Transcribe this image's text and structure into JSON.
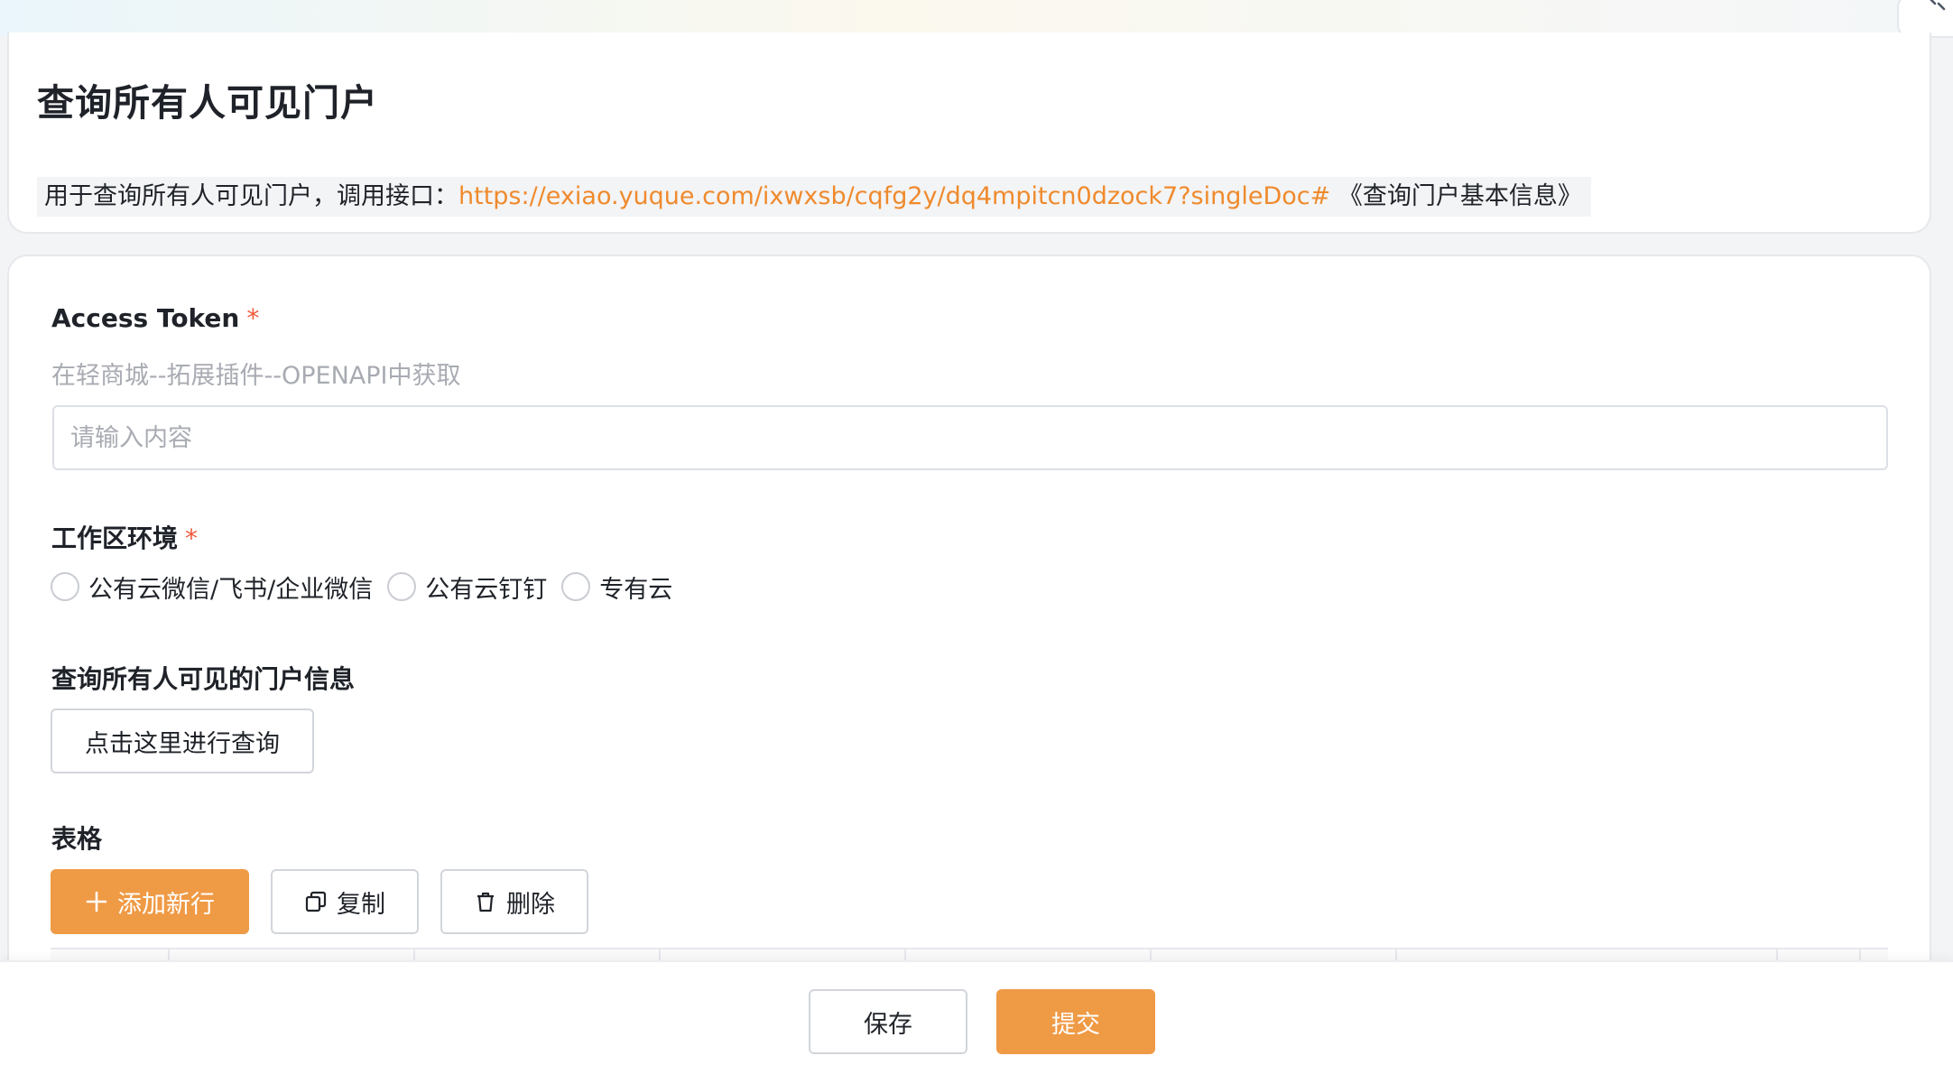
{
  "header": {
    "title": "查询所有人可见门户",
    "description_prefix": "用于查询所有人可见门户，调用接口：",
    "description_link": "https://exiao.yuque.com/ixwxsb/cqfg2y/dq4mpitcn0dzock7?singleDoc#",
    "description_suffix": " 《查询门户基本信息》"
  },
  "form": {
    "access_token": {
      "label": "Access Token",
      "required_mark": "*",
      "hint": "在轻商城--拓展插件--OPENAPI中获取",
      "placeholder": "请输入内容",
      "value": ""
    },
    "workspace": {
      "label": "工作区环境",
      "required_mark": "*",
      "options": [
        "公有云微信/飞书/企业微信",
        "公有云钉钉",
        "专有云"
      ],
      "selected": null
    },
    "query": {
      "label": "查询所有人可见的门户信息",
      "button_label": "点击这里进行查询"
    },
    "table": {
      "label": "表格",
      "add_row_label": "添加新行",
      "copy_label": "复制",
      "delete_label": "删除"
    }
  },
  "footer": {
    "save_label": "保存",
    "submit_label": "提交"
  },
  "colors": {
    "accent": "#ef9a45",
    "link": "#ef8a2d",
    "required": "#f05a3c",
    "hint_text": "#a8abb2",
    "border": "#dcdfe6"
  },
  "icons": {
    "add_row": "plus-icon",
    "copy": "copy-icon",
    "delete": "trash-icon",
    "corner": "link-icon"
  }
}
